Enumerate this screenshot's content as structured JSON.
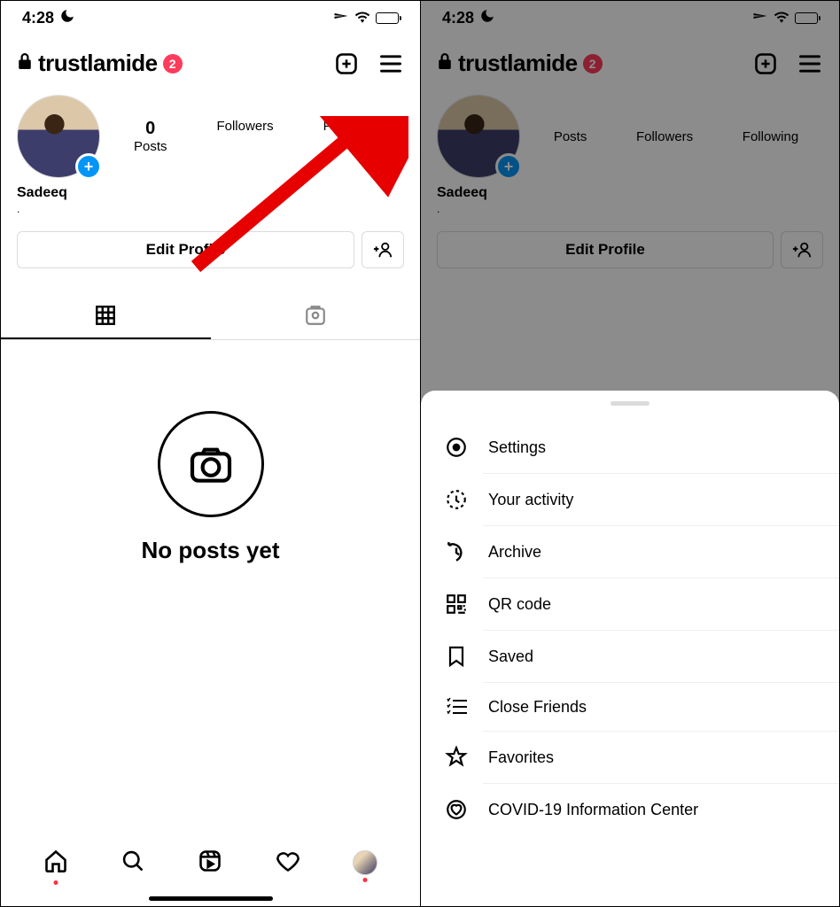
{
  "status": {
    "time": "4:28"
  },
  "profile": {
    "username": "trustlamide",
    "badge_count": "2",
    "display_name": "Sadeeq",
    "posts_count": "0",
    "posts_label": "Posts",
    "followers_label": "Followers",
    "following_label": "Following",
    "edit_profile_label": "Edit Profile"
  },
  "empty_state": {
    "text": "No posts yet"
  },
  "menu": {
    "items": [
      {
        "icon": "settings",
        "label": "Settings"
      },
      {
        "icon": "activity",
        "label": "Your activity"
      },
      {
        "icon": "archive",
        "label": "Archive"
      },
      {
        "icon": "qr",
        "label": "QR code"
      },
      {
        "icon": "saved",
        "label": "Saved"
      },
      {
        "icon": "close-friends",
        "label": "Close Friends"
      },
      {
        "icon": "favorites",
        "label": "Favorites"
      },
      {
        "icon": "covid",
        "label": "COVID-19 Information Center"
      }
    ]
  }
}
